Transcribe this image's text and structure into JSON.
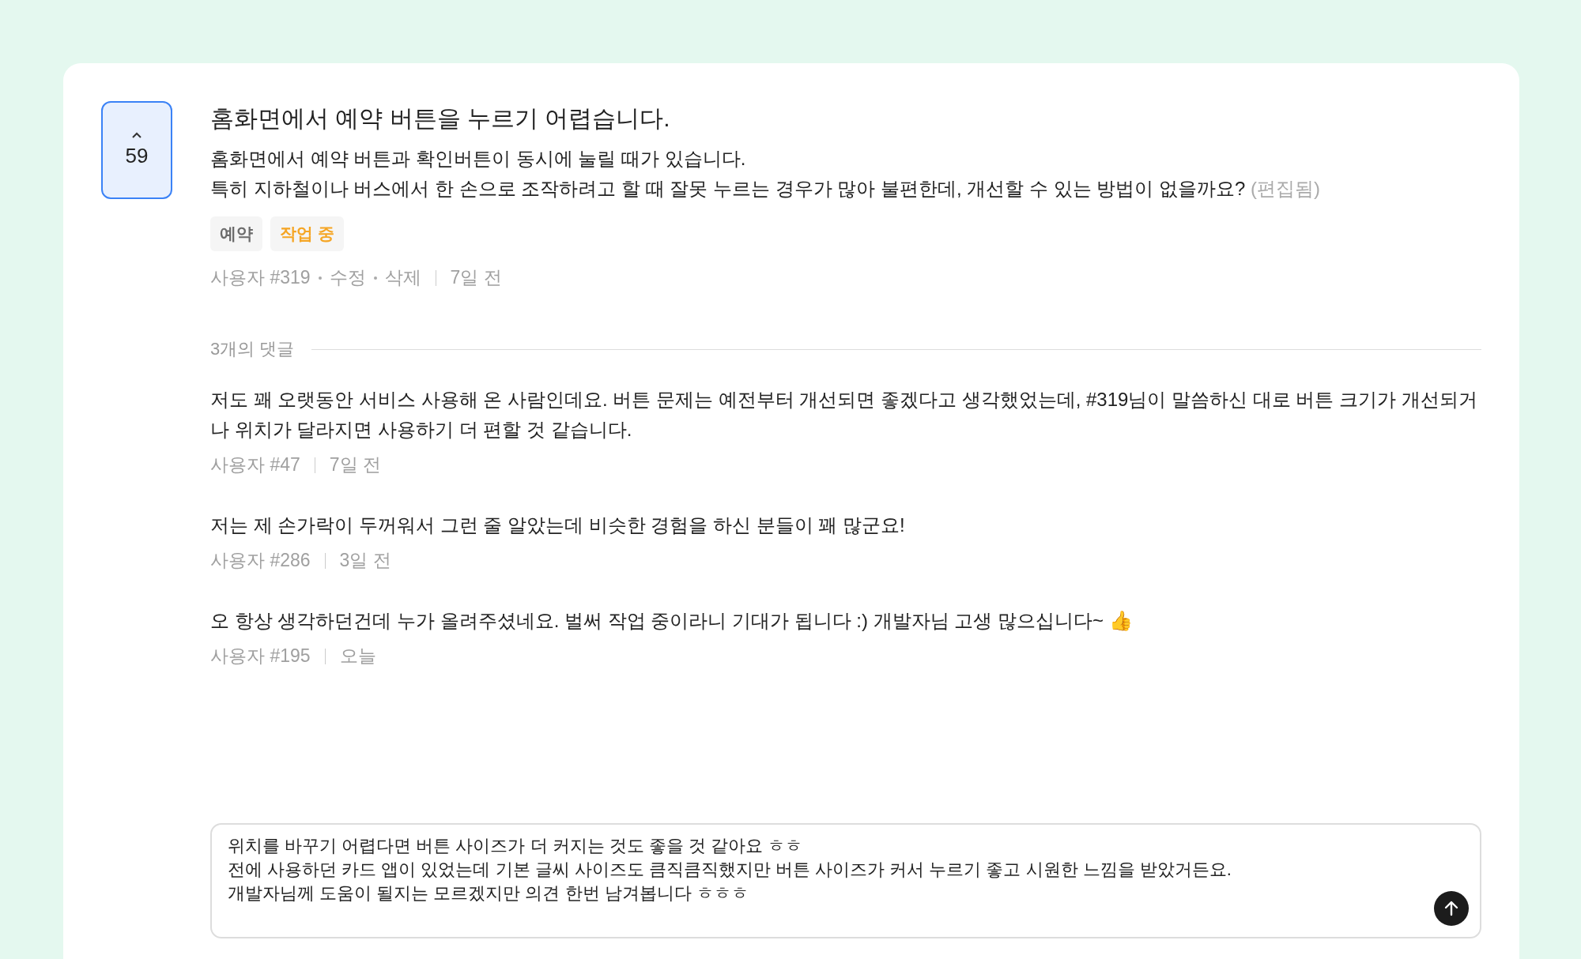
{
  "post": {
    "votes": "59",
    "voted": true,
    "title": "홈화면에서 예약 버튼을 누르기 어렵습니다.",
    "body": "홈화면에서 예약 버튼과 확인버튼이 동시에 눌릴 때가 있습니다.\n특히 지하철이나 버스에서 한 손으로 조작하려고 할 때 잘못 누르는 경우가 많아 불편한데, 개선할 수 있는 방법이 없을까요?",
    "edited_note": "(편집됨)",
    "tags": [
      {
        "label": "예약",
        "color": "#6b6b6b"
      },
      {
        "label": "작업 중",
        "color": "#f5a524"
      }
    ],
    "author": "사용자 #319",
    "actions": [
      "수정",
      "삭제"
    ],
    "time": "7일 전"
  },
  "comments_header": "3개의 댓글",
  "comments": [
    {
      "text": "저도 꽤 오랫동안 서비스 사용해 온 사람인데요. 버튼 문제는 예전부터 개선되면 좋겠다고 생각했었는데, #319님이 말씀하신 대로 버튼 크기가 개선되거나 위치가 달라지면 사용하기 더 편할 것 같습니다.",
      "author": "사용자 #47",
      "time": "7일 전"
    },
    {
      "text": "저는 제 손가락이 두꺼워서 그런 줄 알았는데 비슷한 경험을 하신 분들이 꽤 많군요!",
      "author": "사용자 #286",
      "time": "3일 전"
    },
    {
      "text": "오 항상 생각하던건데 누가 올려주셨네요. 벌써 작업 중이라니 기대가 됩니다 :) 개발자님 고생 많으십니다~ 👍",
      "author": "사용자 #195",
      "time": "오늘"
    }
  ],
  "reply": {
    "value": "위치를 바꾸기 어렵다면 버튼 사이즈가 더 커지는 것도 좋을 것 같아요 ㅎㅎ\n전에 사용하던 카드 앱이 있었는데 기본 글씨 사이즈도 큼직큼직했지만 버튼 사이즈가 커서 누르기 좋고 시원한 느낌을 받았거든요.\n개발자님께 도움이 될지는 모르겠지만 의견 한번 남겨봅니다 ㅎㅎㅎ"
  }
}
